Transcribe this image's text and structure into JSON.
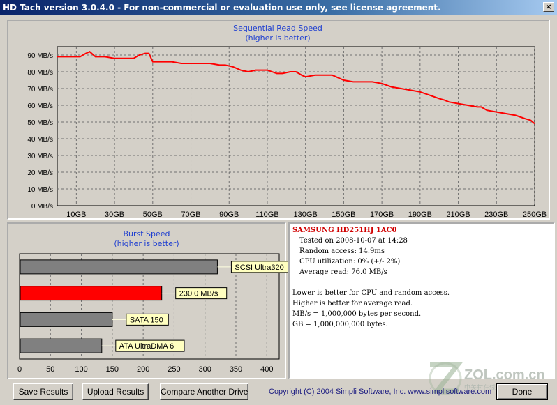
{
  "window": {
    "title": "HD Tach version 3.0.4.0  - For non-commercial or evaluation use only, see license agreement.",
    "close_glyph": "×"
  },
  "read_chart": {
    "title": "Sequential Read Speed",
    "subtitle": "(higher is better)",
    "line_color": "#ff0000"
  },
  "burst_chart": {
    "title": "Burst Speed",
    "subtitle": "(higher is better)"
  },
  "chart_data": [
    {
      "type": "line",
      "title": "Sequential Read Speed",
      "subtitle": "(higher is better)",
      "y_tick_labels": [
        "90 MB/s",
        "80 MB/s",
        "70 MB/s",
        "60 MB/s",
        "50 MB/s",
        "40 MB/s",
        "30 MB/s",
        "20 MB/s",
        "10 MB/s",
        "0 MB/s"
      ],
      "x_tick_labels": [
        "10GB",
        "30GB",
        "50GB",
        "70GB",
        "90GB",
        "110GB",
        "130GB",
        "150GB",
        "170GB",
        "190GB",
        "210GB",
        "230GB",
        "250GB"
      ],
      "xlim": [
        0,
        250
      ],
      "ylim": [
        0,
        95
      ],
      "grid": true,
      "series": [
        {
          "color": "#ff0000",
          "x": [
            0,
            12,
            15,
            17,
            20,
            25,
            30,
            35,
            40,
            43,
            46,
            48,
            50,
            55,
            60,
            65,
            70,
            75,
            80,
            85,
            88,
            92,
            96,
            100,
            104,
            107,
            110,
            115,
            118,
            122,
            125,
            128,
            130,
            135,
            140,
            144,
            146,
            150,
            155,
            160,
            165,
            170,
            175,
            180,
            185,
            190,
            195,
            200,
            203,
            205,
            210,
            215,
            220,
            222,
            225,
            230,
            235,
            240,
            245,
            248,
            250
          ],
          "y": [
            89,
            89,
            91,
            92,
            89,
            89,
            88,
            88,
            88,
            90,
            91,
            91,
            86,
            86,
            86,
            85,
            85,
            85,
            85,
            84,
            84,
            83,
            81,
            80,
            81,
            81,
            81,
            79,
            79,
            80,
            80,
            78,
            77,
            78,
            78,
            78,
            77,
            75,
            74,
            74,
            74,
            73,
            71,
            70,
            69,
            68,
            66,
            64,
            63,
            62,
            61,
            60,
            59,
            59,
            57,
            56,
            55,
            54,
            52,
            51,
            49
          ]
        }
      ]
    },
    {
      "type": "bar",
      "title": "Burst Speed",
      "subtitle": "(higher is better)",
      "categories": [
        "SCSI Ultra320",
        "230.0 MB/s",
        "SATA 150",
        "ATA UltraDMA 6"
      ],
      "values": [
        320,
        230,
        150,
        133
      ],
      "colors": [
        "#808080",
        "#ff0000",
        "#808080",
        "#808080"
      ],
      "x_tick_labels": [
        "0",
        "50",
        "100",
        "150",
        "200",
        "250",
        "300",
        "350",
        "400"
      ],
      "xlim": [
        0,
        420
      ]
    }
  ],
  "info": {
    "drive": "SAMSUNG HD251HJ  1AC0",
    "lines": [
      "Tested on 2008-10-07 at 14:28",
      "Random access: 14.9ms",
      "CPU utilization: 0% (+/- 2%)",
      "Average read: 76.0 MB/s"
    ],
    "notes": [
      "Lower is better for CPU and random access.",
      "Higher is better for average read.",
      "MB/s = 1,000,000 bytes per second.",
      "GB = 1,000,000,000 bytes."
    ]
  },
  "buttons": {
    "save": "Save Results",
    "upload": "Upload Results",
    "compare": "Compare Another Drive",
    "done": "Done"
  },
  "footer": {
    "copyright": "Copyright (C) 2004 Simpli Software, Inc. www.simplisoftware.com"
  },
  "watermark": {
    "text": "ZOL.com.cn",
    "sub": "中关村在线"
  }
}
